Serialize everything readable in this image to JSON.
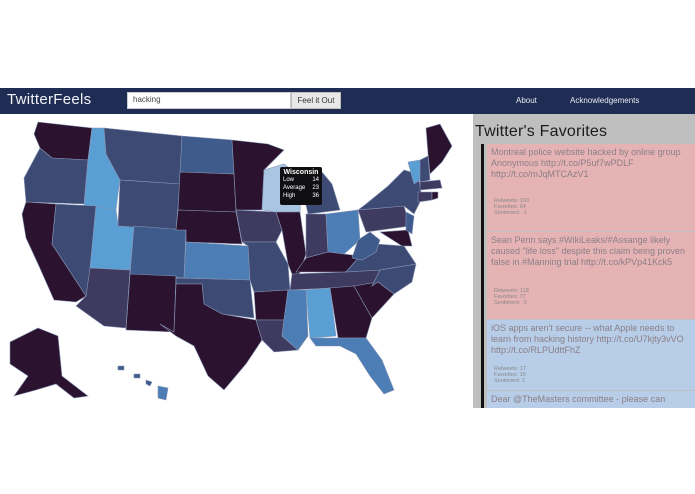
{
  "navbar": {
    "brand": "TwitterFeels",
    "search_value": "hacking",
    "search_placeholder": "",
    "button_label": "Feel it Out",
    "links": [
      "About",
      "Acknowledgements"
    ]
  },
  "tooltip": {
    "state": "Wisconsin",
    "rows": [
      {
        "label": "Low",
        "value": "14"
      },
      {
        "label": "Average",
        "value": "23"
      },
      {
        "label": "High",
        "value": "36"
      }
    ]
  },
  "sidebar": {
    "title": "Twitter's Favorites",
    "tweets": [
      {
        "text": "Montreal police website hacked by online group Anonymous http://t.co/P5uf7wPDLF http://t.co/mJqMTCAzV1",
        "retweets": "Retweets: 100",
        "favorites": "Favorites: 64",
        "sentiment": "Sentiment: -1",
        "color": "#e6b3b5"
      },
      {
        "text": "Sean Penn says #WikiLeaks/#Assange likely caused \"life loss\" despite this claim being proven false in #Manning trial http://t.co/kPVp41Kck5",
        "retweets": "Retweets: 118",
        "favorites": "Favorites: 77",
        "sentiment": "Sentiment: -3",
        "color": "#e6b3b5"
      },
      {
        "text": "iOS apps aren't secure -- what Apple needs to learn from hacking history http://t.co/U7kjty3vVO http://t.co/RLPUdttFhZ",
        "retweets": "Retweets: 17",
        "favorites": "Favorites: 16",
        "sentiment": "Sentiment: 2",
        "color": "#b7cde8"
      },
      {
        "text": "Dear @TheMasters committee - please can",
        "retweets": "",
        "favorites": "",
        "sentiment": "",
        "color": "#b7cde8"
      }
    ]
  },
  "map_colors": {
    "darkest": "#2b1330",
    "dark": "#3a2446",
    "mid_dark": "#3e3a60",
    "mid": "#3d4a74",
    "blue_mid": "#3e5b8c",
    "blue": "#4c7db5",
    "light_blue": "#5a9fd4",
    "pale": "#a8c6e2"
  }
}
